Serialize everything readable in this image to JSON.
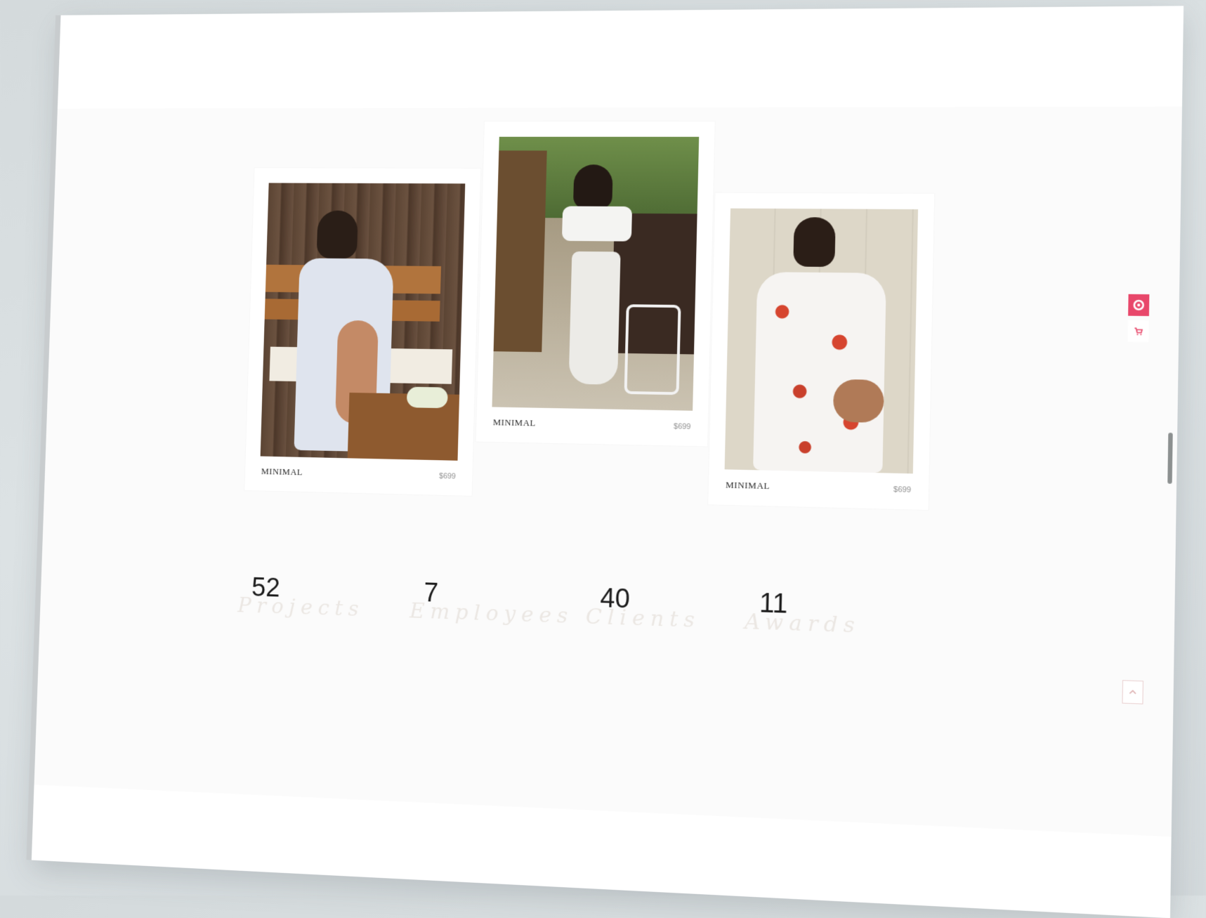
{
  "products": [
    {
      "title": "MINIMAL",
      "price": "$699",
      "photo": "woman-white-dress-bench"
    },
    {
      "title": "MINIMAL",
      "price": "$699",
      "photo": "woman-white-crop-top-skirt"
    },
    {
      "title": "MINIMAL",
      "price": "$699",
      "photo": "woman-floral-dress-chair"
    }
  ],
  "stats": [
    {
      "number": "52",
      "label": "Projects"
    },
    {
      "number": "7",
      "label": "Employees"
    },
    {
      "number": "40",
      "label": "Clients"
    },
    {
      "number": "11",
      "label": "Awards"
    }
  ],
  "sidebar": {
    "settings_icon": "gear-icon",
    "cart_icon": "cart-icon"
  },
  "scroll_top": {
    "icon": "chevron-up-icon"
  },
  "colors": {
    "accent": "#e8476a",
    "text": "#2c2c2c",
    "muted": "#8f8f8f"
  }
}
